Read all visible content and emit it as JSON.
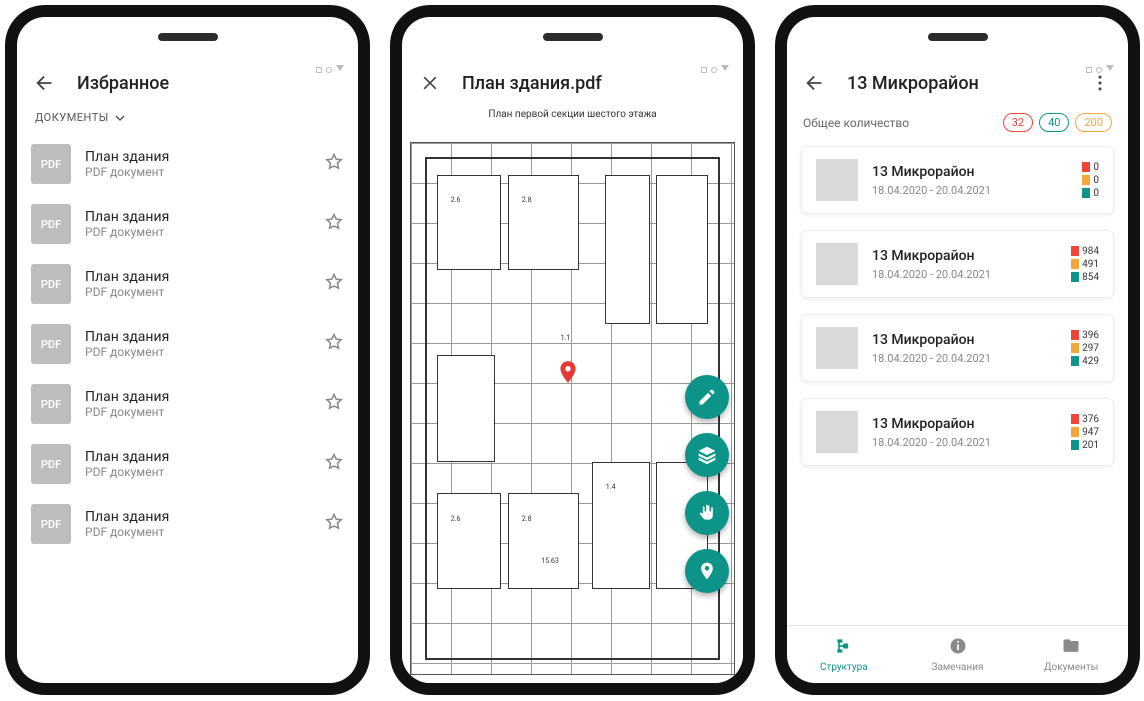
{
  "screen1": {
    "title": "Избранное",
    "filter_label": "ДОКУМЕНТЫ",
    "items": [
      {
        "badge": "PDF",
        "title": "План здания",
        "subtitle": "PDF документ"
      },
      {
        "badge": "PDF",
        "title": "План здания",
        "subtitle": "PDF документ"
      },
      {
        "badge": "PDF",
        "title": "План здания",
        "subtitle": "PDF документ"
      },
      {
        "badge": "PDF",
        "title": "План здания",
        "subtitle": "PDF документ"
      },
      {
        "badge": "PDF",
        "title": "План здания",
        "subtitle": "PDF документ"
      },
      {
        "badge": "PDF",
        "title": "План здания",
        "subtitle": "PDF документ"
      },
      {
        "badge": "PDF",
        "title": "План здания",
        "subtitle": "PDF документ"
      }
    ]
  },
  "screen2": {
    "title": "План здания.pdf",
    "caption": "План первой секции шестого этажа",
    "fabs": [
      "edit",
      "layers",
      "hand",
      "pin"
    ]
  },
  "screen3": {
    "title": "13 Микрорайон",
    "totals_label": "Общее количество",
    "pills": [
      {
        "value": "32",
        "color": "#f04438"
      },
      {
        "value": "40",
        "color": "#0d9488"
      },
      {
        "value": "200",
        "color": "#f2a73b"
      }
    ],
    "cards": [
      {
        "title": "13 Микрорайон",
        "dates": "18.04.2020 - 20.04.2021",
        "stats": [
          {
            "v": "0",
            "c": "#f04438"
          },
          {
            "v": "0",
            "c": "#f2a73b"
          },
          {
            "v": "0",
            "c": "#0d9488"
          }
        ]
      },
      {
        "title": "13 Микрорайон",
        "dates": "18.04.2020 - 20.04.2021",
        "stats": [
          {
            "v": "984",
            "c": "#f04438"
          },
          {
            "v": "491",
            "c": "#f2a73b"
          },
          {
            "v": "854",
            "c": "#0d9488"
          }
        ]
      },
      {
        "title": "13 Микрорайон",
        "dates": "18.04.2020 - 20.04.2021",
        "stats": [
          {
            "v": "396",
            "c": "#f04438"
          },
          {
            "v": "297",
            "c": "#f2a73b"
          },
          {
            "v": "429",
            "c": "#0d9488"
          }
        ]
      },
      {
        "title": "13 Микрорайон",
        "dates": "18.04.2020 - 20.04.2021",
        "stats": [
          {
            "v": "376",
            "c": "#f04438"
          },
          {
            "v": "947",
            "c": "#f2a73b"
          },
          {
            "v": "201",
            "c": "#0d9488"
          }
        ]
      }
    ],
    "nav": [
      {
        "label": "Структура",
        "icon": "tree",
        "active": true
      },
      {
        "label": "Замечания",
        "icon": "info",
        "active": false
      },
      {
        "label": "Документы",
        "icon": "folder",
        "active": false
      }
    ]
  }
}
